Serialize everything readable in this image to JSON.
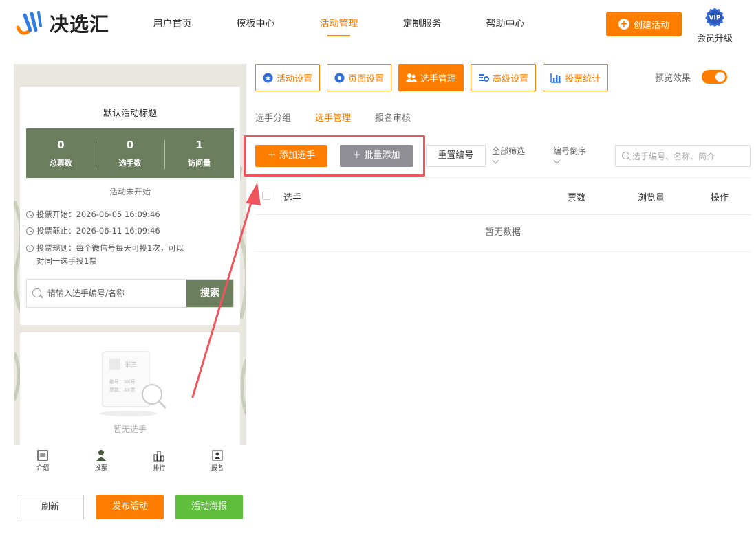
{
  "brand": {
    "name": "决选汇"
  },
  "nav": {
    "items": [
      "用户首页",
      "模板中心",
      "活动管理",
      "定制服务",
      "帮助中心"
    ],
    "active_index": 2,
    "create_button": "创建活动",
    "vip_badge": "VIP",
    "vip_label": "会员升级"
  },
  "preview": {
    "title": "默认活动标题",
    "stats": [
      {
        "value": "0",
        "label": "总票数"
      },
      {
        "value": "0",
        "label": "选手数"
      },
      {
        "value": "1",
        "label": "访问量"
      }
    ],
    "status": "活动未开始",
    "vote_start": "投票开始：2026-06-05 16:09:46",
    "vote_end": "投票截止：2026-06-11 16:09:46",
    "vote_rule": "投票规则：每个微信号每天可投1次，可以对同一选手投1票",
    "search_placeholder": "请输入选手编号/名称",
    "search_button": "搜索",
    "empty_card": {
      "name": "张三",
      "number": "编号：XX号",
      "votes": "票数：XX票",
      "text": "暂无选手"
    },
    "tabs": [
      "介绍",
      "投票",
      "排行",
      "报名"
    ],
    "colors": {
      "theme": "#6b7f5f"
    }
  },
  "bottom_buttons": {
    "refresh": "刷新",
    "publish": "发布活动",
    "poster": "活动海报"
  },
  "toolbar": {
    "tabs": [
      {
        "label": "活动设置",
        "icon": "star-badge-icon"
      },
      {
        "label": "页面设置",
        "icon": "gear-flower-icon"
      },
      {
        "label": "选手管理",
        "icon": "users-icon"
      },
      {
        "label": "高级设置",
        "icon": "sliders-gear-icon"
      },
      {
        "label": "投票统计",
        "icon": "bar-chart-icon"
      }
    ],
    "active_index": 2,
    "preview_label": "预览效果",
    "preview_on": true
  },
  "subtabs": {
    "items": [
      "选手分组",
      "选手管理",
      "报名审核"
    ],
    "active_index": 1
  },
  "actions": {
    "add": "＋ 添加选手",
    "batch": "＋ 批量添加",
    "renumber": "重置编号",
    "filter": "全部筛选",
    "sort": "编号倒序",
    "search_placeholder": "选手编号、名称、简介"
  },
  "table": {
    "columns": [
      "选手",
      "票数",
      "浏览量",
      "操作"
    ],
    "empty": "暂无数据"
  },
  "colors": {
    "accent": "#ff7e00",
    "highlight": "#f0545c",
    "green": "#5fbf3c"
  }
}
